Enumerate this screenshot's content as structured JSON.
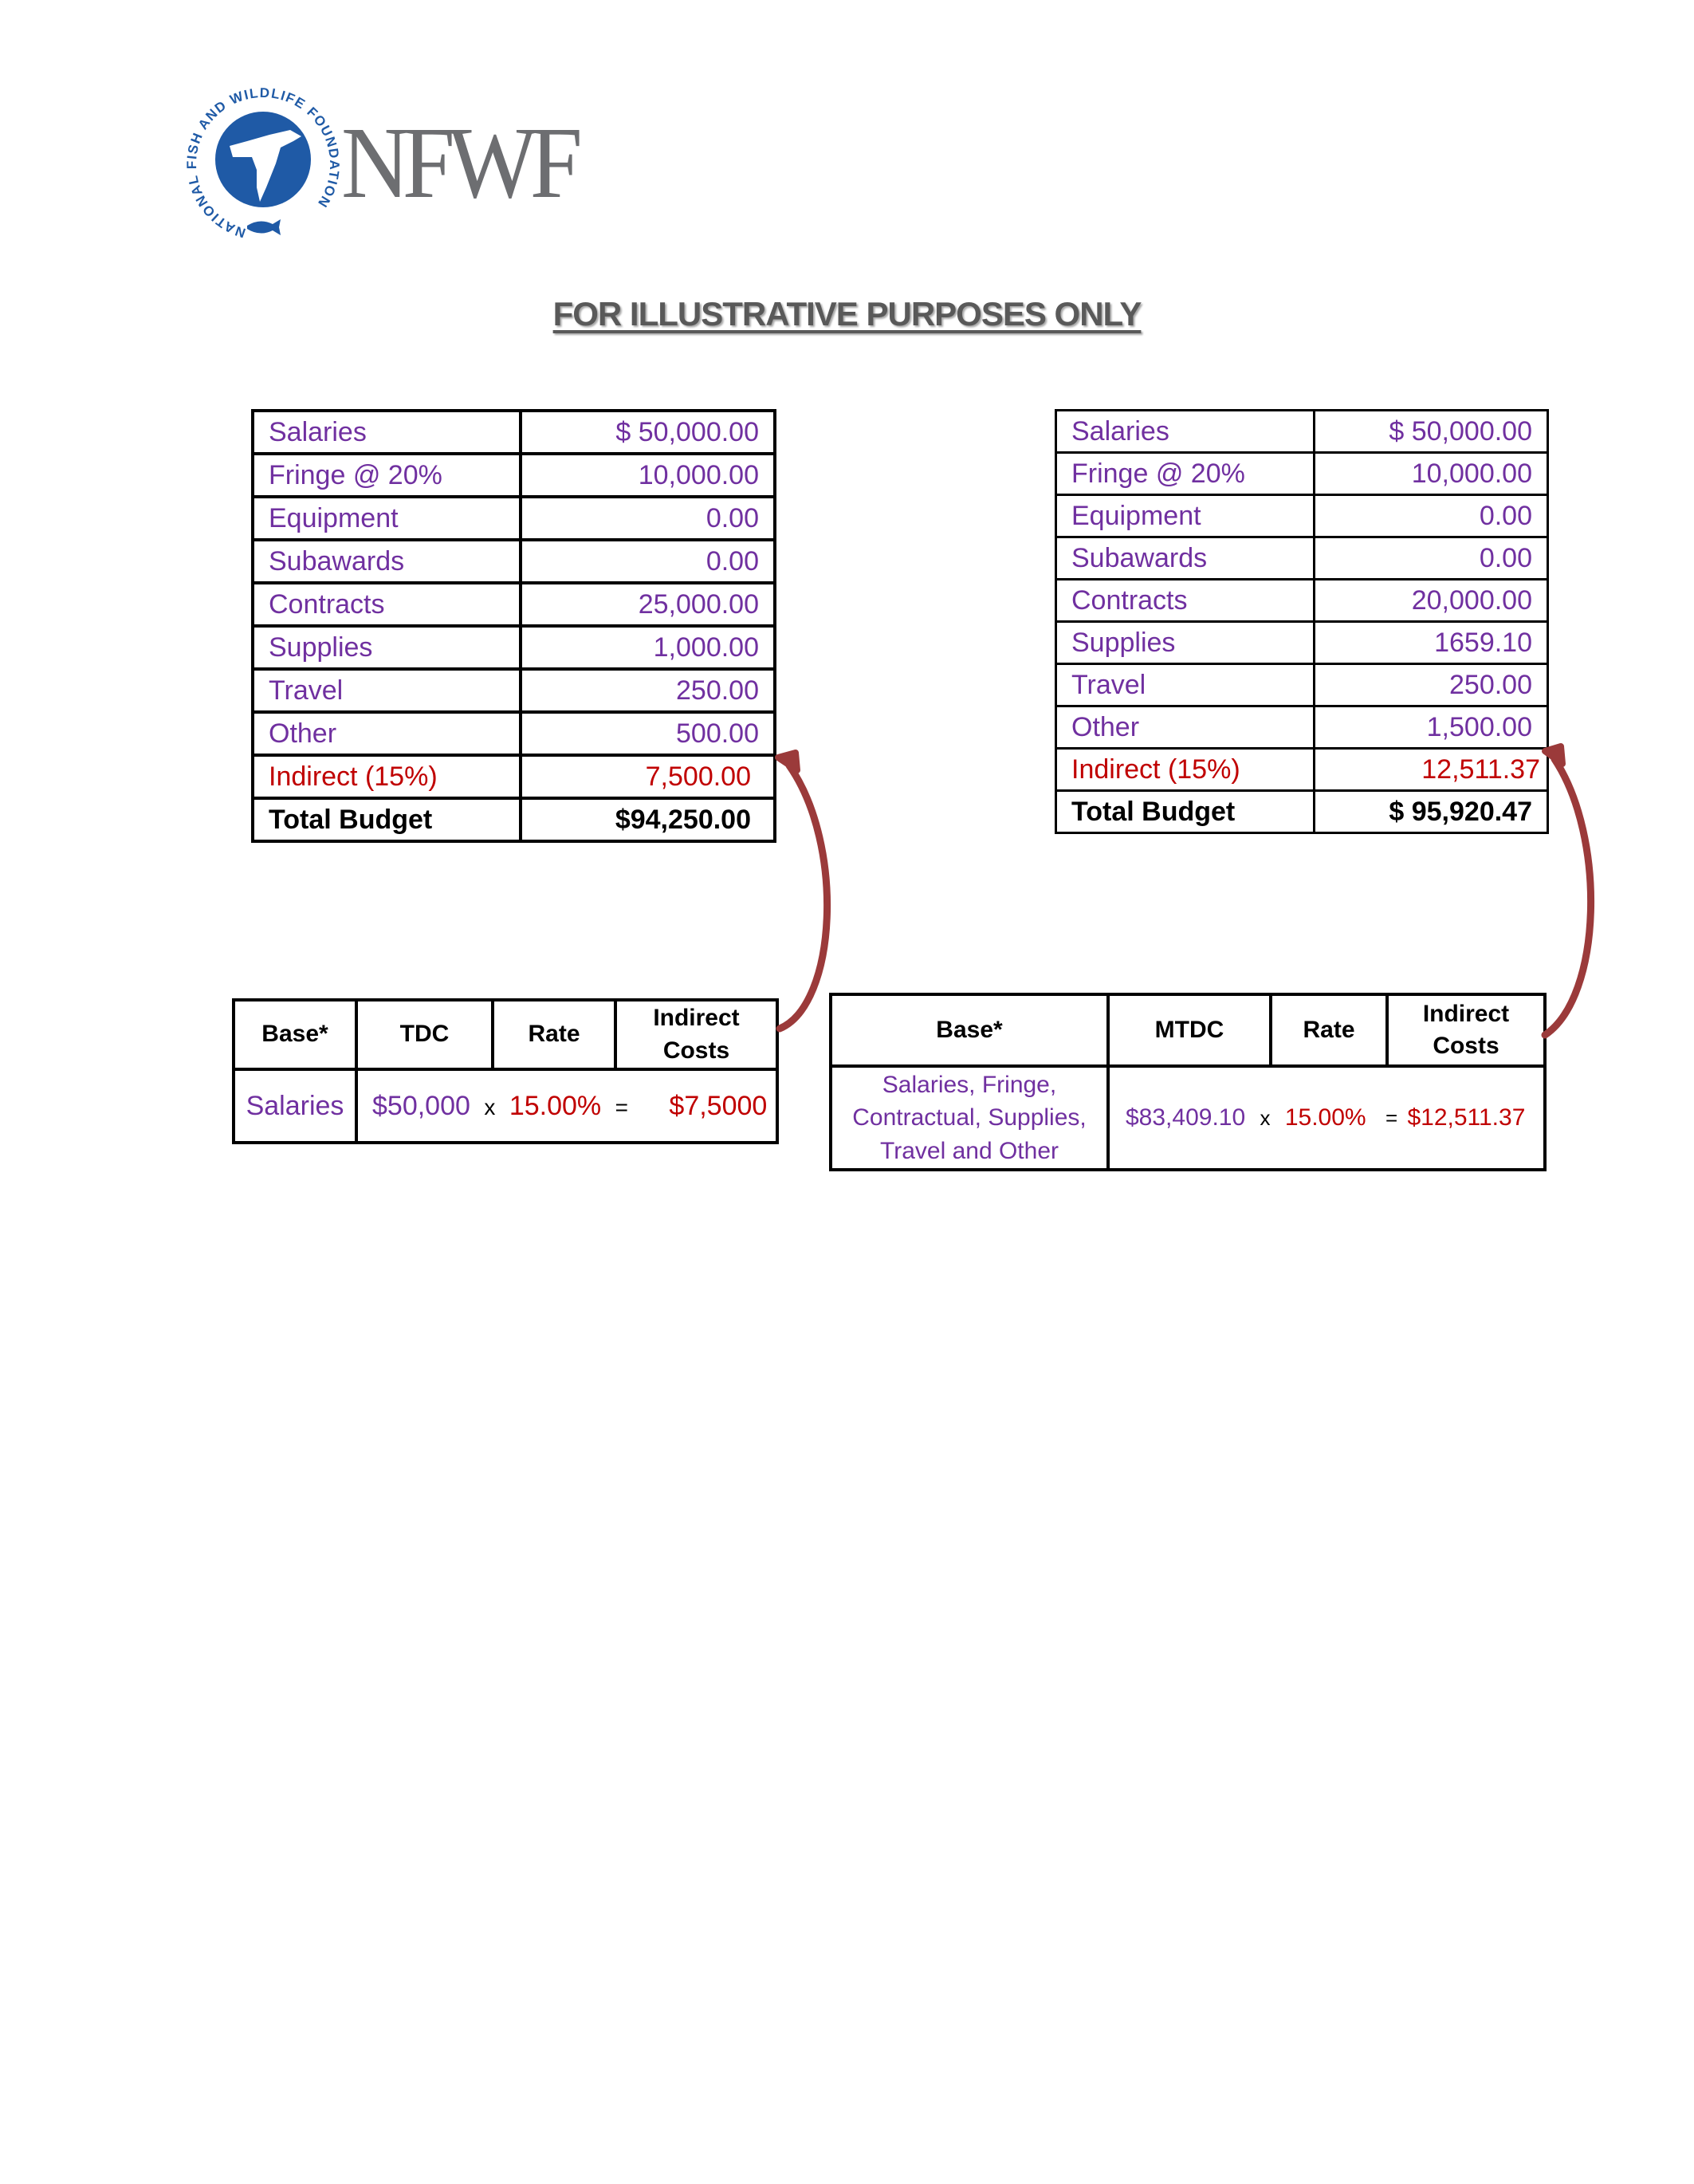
{
  "logo": {
    "ring_text": "NATIONAL FISH AND WILDLIFE FOUNDATION",
    "wordmark": "NFWF",
    "brand_blue": "#1f5aa6",
    "wordmark_gray": "#6d6e71"
  },
  "title": "FOR ILLUSTRATIVE PURPOSES ONLY",
  "colors": {
    "line_item": "#7030a0",
    "indirect": "#c00000",
    "total": "#000000",
    "arrow": "#9b3a3a"
  },
  "budget_left": {
    "rows": [
      {
        "label": "Salaries",
        "value": "$ 50,000.00"
      },
      {
        "label": "Fringe @ 20%",
        "value": "10,000.00"
      },
      {
        "label": "Equipment",
        "value": "0.00"
      },
      {
        "label": "Subawards",
        "value": "0.00"
      },
      {
        "label": "Contracts",
        "value": "25,000.00"
      },
      {
        "label": "Supplies",
        "value": "1,000.00"
      },
      {
        "label": "Travel",
        "value": "250.00"
      },
      {
        "label": "Other",
        "value": "500.00"
      },
      {
        "label": "Indirect (15%)",
        "value": "7,500.00"
      },
      {
        "label": "Total Budget",
        "value": "$94,250.00"
      }
    ]
  },
  "budget_right": {
    "rows": [
      {
        "label": "Salaries",
        "value": "$ 50,000.00"
      },
      {
        "label": "Fringe @ 20%",
        "value": "10,000.00"
      },
      {
        "label": "Equipment",
        "value": "0.00"
      },
      {
        "label": "Subawards",
        "value": "0.00"
      },
      {
        "label": "Contracts",
        "value": "20,000.00"
      },
      {
        "label": "Supplies",
        "value": "1659.10"
      },
      {
        "label": "Travel",
        "value": "250.00"
      },
      {
        "label": "Other",
        "value": "1,500.00"
      },
      {
        "label": "Indirect (15%)",
        "value": "12,511.37"
      },
      {
        "label": "Total Budget",
        "value": "$ 95,920.47"
      }
    ]
  },
  "calc_left": {
    "headers": [
      "Base*",
      "TDC",
      "Rate",
      "Indirect\nCosts"
    ],
    "header_indirect_line1": "Indirect",
    "header_indirect_line2": "Costs",
    "base": "Salaries",
    "amount": "$50,000",
    "times": "x",
    "rate": "15.00%",
    "equals": "=",
    "result": "$7,5000"
  },
  "calc_right": {
    "header_base": "Base*",
    "header_amount": "MTDC",
    "header_rate": "Rate",
    "header_indirect_line1": "Indirect",
    "header_indirect_line2": "Costs",
    "base_line1": "Salaries, Fringe,",
    "base_line2": "Contractual, Supplies,",
    "base_line3": "Travel and Other",
    "amount": "$83,409.10",
    "times": "x",
    "rate": "15.00%",
    "equals": "=",
    "result": "$12,511.37"
  }
}
